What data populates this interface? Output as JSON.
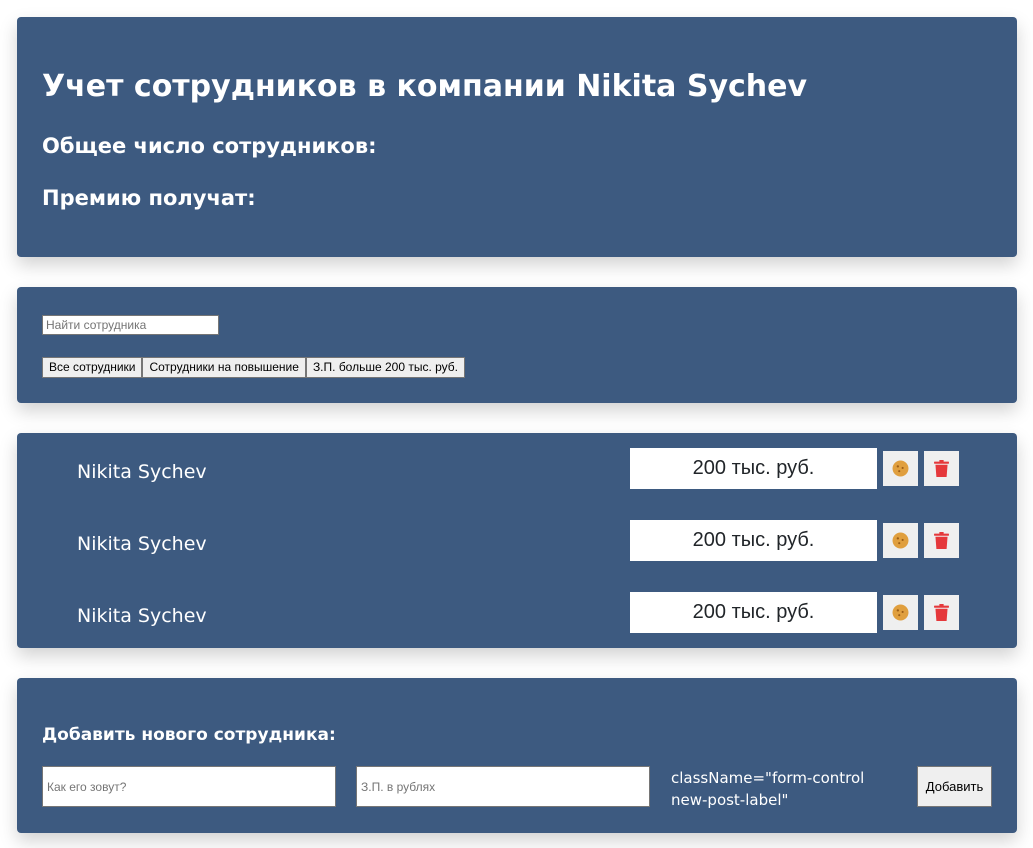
{
  "header": {
    "title": "Учет сотрудников в компании Nikita Sychev",
    "total_label": "Общее число сотрудников:",
    "bonus_label": "Премию получат:"
  },
  "search": {
    "placeholder": "Найти сотрудника",
    "value": ""
  },
  "filters": [
    {
      "label": "Все сотрудники"
    },
    {
      "label": "Сотрудники на повышение"
    },
    {
      "label": "З.П. больше 200 тыс. руб."
    }
  ],
  "employees": [
    {
      "name": "Nikita Sychev",
      "salary": "200 тыс. руб."
    },
    {
      "name": "Nikita Sychev",
      "salary": "200 тыс. руб."
    },
    {
      "name": "Nikita Sychev",
      "salary": "200 тыс. руб."
    }
  ],
  "icons": {
    "promote": "cookie-icon",
    "delete": "trash-icon"
  },
  "colors": {
    "panel_bg": "#3d5a80",
    "cookie": "#e09f3e",
    "trash": "#e5383b"
  },
  "add_form": {
    "title": "Добавить нового сотрудника:",
    "name_placeholder": "Как его зовут?",
    "salary_placeholder": "З.П. в рублях",
    "stray_text": "className=\"form-control new-post-label\"",
    "submit_label": "Добавить"
  }
}
